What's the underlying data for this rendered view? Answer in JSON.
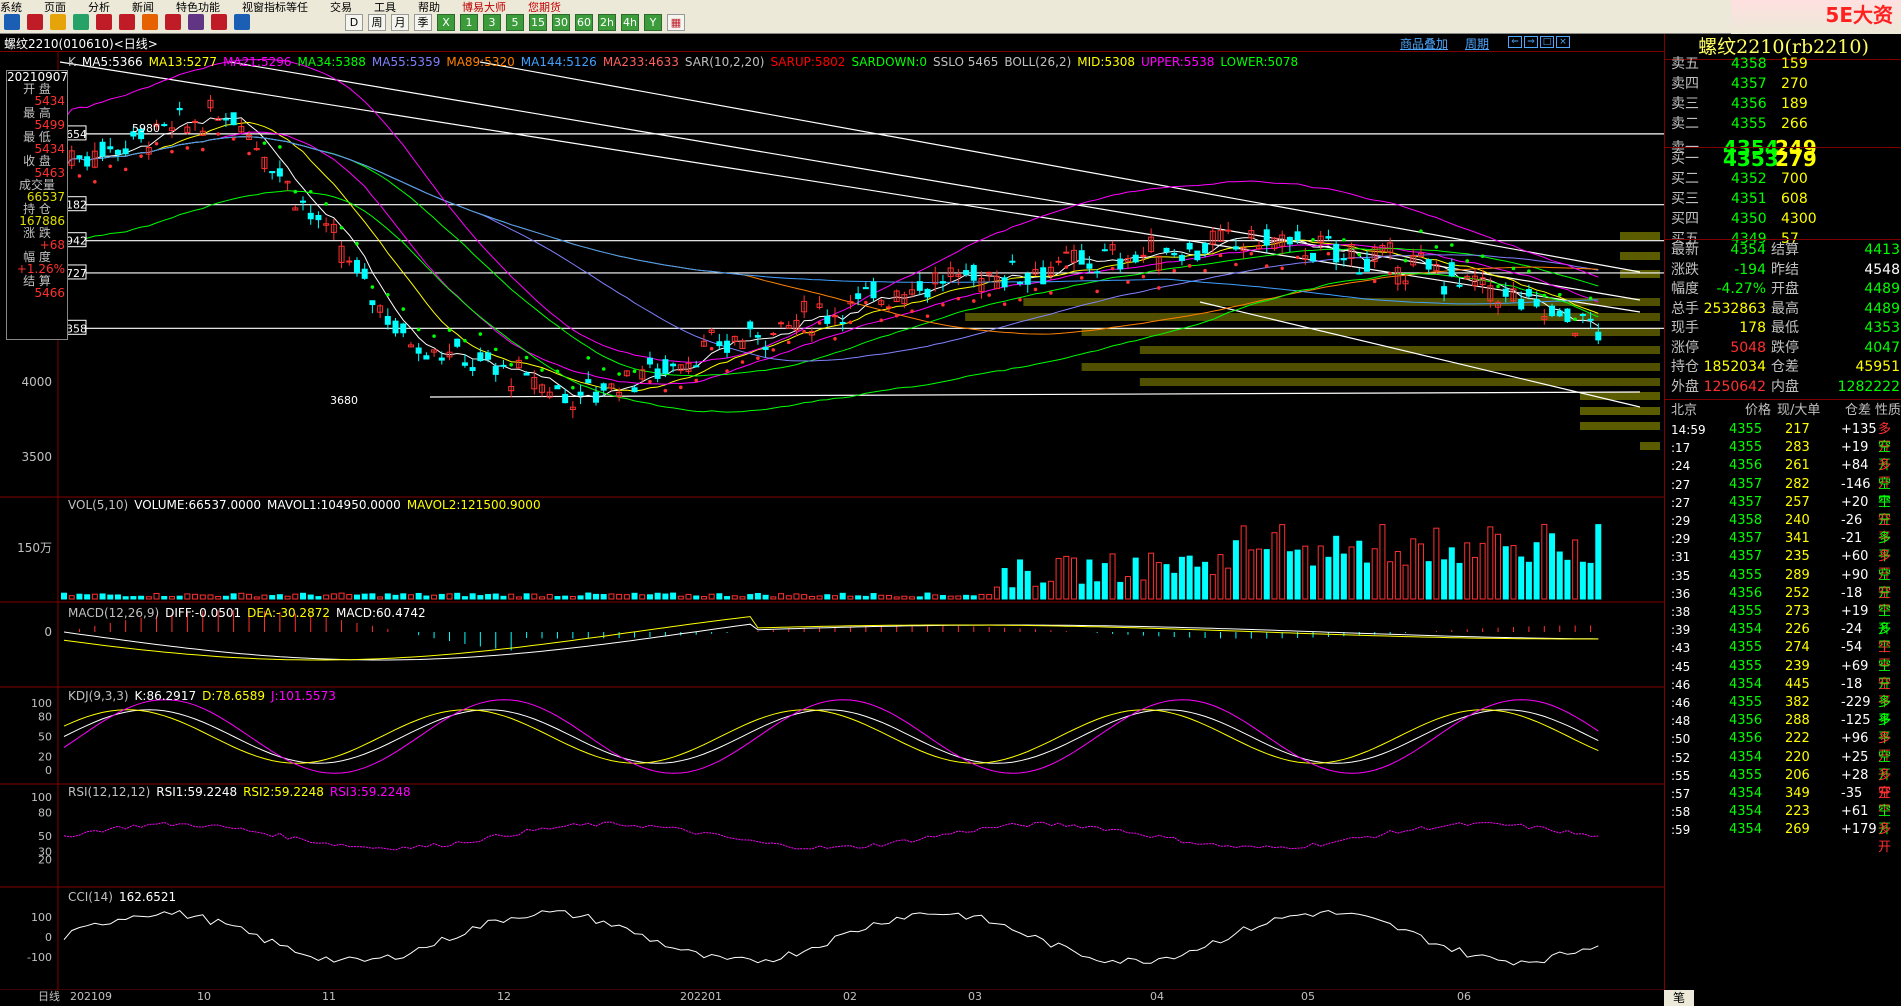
{
  "menu": [
    "系统",
    "页面",
    "分析",
    "新闻",
    "特色功能",
    "视窗指标等任",
    "交易",
    "工具",
    "帮助",
    "博易大师",
    "您期货"
  ],
  "logo_text": "5E大资5etz.com",
  "toolbar_buttons": [
    "D",
    "周",
    "月",
    "季",
    "X",
    "1",
    "3",
    "5",
    "15",
    "30",
    "60",
    "2h",
    "4h",
    "Y",
    "▦"
  ],
  "chart_header": {
    "title": "螺纹2210(010610)<日线>",
    "right_link1": "商品叠加",
    "right_link2": "周期"
  },
  "main_indicators": [
    {
      "text": "K",
      "color": "#c0c0c0"
    },
    {
      "text": "MA5:5366",
      "color": "#ffffff"
    },
    {
      "text": "MA13:5277",
      "color": "#ffff00"
    },
    {
      "text": "MA21:5296",
      "color": "#ff00ff"
    },
    {
      "text": "MA34:5388",
      "color": "#00ff00"
    },
    {
      "text": "MA55:5359",
      "color": "#8080ff"
    },
    {
      "text": "MA89:5320",
      "color": "#ff8000"
    },
    {
      "text": "MA144:5126",
      "color": "#40a0ff"
    },
    {
      "text": "MA233:4633",
      "color": "#ff6060"
    },
    {
      "text": "SAR(10,2,20)",
      "color": "#c0c0c0"
    },
    {
      "text": "SARUP:5802",
      "color": "#ff0000"
    },
    {
      "text": "SARDOWN:0",
      "color": "#00ff00"
    },
    {
      "text": "SSLO 5465",
      "color": "#c0c0c0"
    },
    {
      "text": "BOLL(26,2)",
      "color": "#c0c0c0"
    },
    {
      "text": "MID:5308",
      "color": "#ffff00"
    },
    {
      "text": "UPPER:5538",
      "color": "#ff00ff"
    },
    {
      "text": "LOWER:5078",
      "color": "#00ff00"
    }
  ],
  "ohlc_box": {
    "date": "20210907",
    "items": [
      {
        "label": "开 盘",
        "value": "5434"
      },
      {
        "label": "最 高",
        "value": "5499"
      },
      {
        "label": "最 低",
        "value": "5434"
      },
      {
        "label": "收 盘",
        "value": "5463"
      },
      {
        "label": "成交量",
        "value": "66537"
      },
      {
        "label": "持 仓",
        "value": "167886"
      },
      {
        "label": "涨 跌",
        "value": "+68"
      },
      {
        "label": "幅 度",
        "value": "+1.26%"
      },
      {
        "label": "结 算",
        "value": "5466"
      }
    ]
  },
  "price_labels": {
    "left": [
      "5654",
      "5182",
      "4942",
      "4727",
      "4358"
    ],
    "axis": [
      "4000",
      "3500"
    ],
    "high_mark": "5980",
    "low_mark": "3680"
  },
  "vol_panel": {
    "items": [
      {
        "text": "VOL(5,10)",
        "color": "#c0c0c0"
      },
      {
        "text": "VOLUME:66537.0000",
        "color": "#ffffff"
      },
      {
        "text": "MAVOL1:104950.0000",
        "color": "#ffffff"
      },
      {
        "text": "MAVOL2:121500.9000",
        "color": "#ffff00"
      }
    ],
    "axis": "150万"
  },
  "macd_panel": {
    "items": [
      {
        "text": "MACD(12,26,9)",
        "color": "#c0c0c0"
      },
      {
        "text": "DIFF:-0.0501",
        "color": "#ffffff"
      },
      {
        "text": "DEA:-30.2872",
        "color": "#ffff00"
      },
      {
        "text": "MACD:60.4742",
        "color": "#ffffff"
      }
    ],
    "axis": "0"
  },
  "kdj_panel": {
    "items": [
      {
        "text": "KDJ(9,3,3)",
        "color": "#c0c0c0"
      },
      {
        "text": "K:86.2917",
        "color": "#ffffff"
      },
      {
        "text": "D:78.6589",
        "color": "#ffff00"
      },
      {
        "text": "J:101.5573",
        "color": "#ff00ff"
      }
    ],
    "axis": [
      "100",
      "80",
      "50",
      "20",
      "0"
    ]
  },
  "rsi_panel": {
    "items": [
      {
        "text": "RSI(12,12,12)",
        "color": "#c0c0c0"
      },
      {
        "text": "RSI1:59.2248",
        "color": "#ffffff"
      },
      {
        "text": "RSI2:59.2248",
        "color": "#ffff00"
      },
      {
        "text": "RSI3:59.2248",
        "color": "#ff00ff"
      }
    ],
    "axis": [
      "100",
      "80",
      "50",
      "30",
      "20"
    ]
  },
  "cci_panel": {
    "items": [
      {
        "text": "CCI(14)",
        "color": "#c0c0c0"
      },
      {
        "text": "162.6521",
        "color": "#ffffff"
      }
    ],
    "axis": [
      "100",
      "0",
      "-100"
    ]
  },
  "date_axis": {
    "period": "日线",
    "labels": [
      "202109",
      "10",
      "11",
      "12",
      "202201",
      "02",
      "03",
      "04",
      "05",
      "06"
    ]
  },
  "right_panel": {
    "title": "螺纹2210(rb2210)",
    "asks": [
      {
        "label": "卖五",
        "price": "4358",
        "vol": "159"
      },
      {
        "label": "卖四",
        "price": "4357",
        "vol": "270"
      },
      {
        "label": "卖三",
        "price": "4356",
        "vol": "189"
      },
      {
        "label": "卖二",
        "price": "4355",
        "vol": "266"
      },
      {
        "label": "卖一",
        "price": "4354",
        "vol": "249"
      }
    ],
    "bids": [
      {
        "label": "买一",
        "price": "4353",
        "vol": "279"
      },
      {
        "label": "买二",
        "price": "4352",
        "vol": "700"
      },
      {
        "label": "买三",
        "price": "4351",
        "vol": "608"
      },
      {
        "label": "买四",
        "price": "4350",
        "vol": "4300"
      },
      {
        "label": "买五",
        "price": "4349",
        "vol": "57"
      }
    ],
    "quote": [
      {
        "l1": "最新",
        "v1": "4354",
        "c1": "#00ff00",
        "l2": "结算",
        "v2": "4413",
        "c2": "#00ff00"
      },
      {
        "l1": "涨跌",
        "v1": "-194",
        "c1": "#00ff00",
        "l2": "昨结",
        "v2": "4548",
        "c2": "#ffffff"
      },
      {
        "l1": "幅度",
        "v1": "-4.27%",
        "c1": "#00ff00",
        "l2": "开盘",
        "v2": "4489",
        "c2": "#00ff00"
      },
      {
        "l1": "总手",
        "v1": "2532863",
        "c1": "#ffff00",
        "l2": "最高",
        "v2": "4489",
        "c2": "#00ff00"
      },
      {
        "l1": "现手",
        "v1": "178",
        "c1": "#ffff00",
        "l2": "最低",
        "v2": "4353",
        "c2": "#00ff00"
      },
      {
        "l1": "涨停",
        "v1": "5048",
        "c1": "#ff3030",
        "l2": "跌停",
        "v2": "4047",
        "c2": "#00ff00"
      },
      {
        "l1": "持仓",
        "v1": "1852034",
        "c1": "#ffff00",
        "l2": "仓差",
        "v2": "45951",
        "c2": "#ffff00"
      },
      {
        "l1": "外盘",
        "v1": "1250642",
        "c1": "#ff3030",
        "l2": "内盘",
        "v2": "1282222",
        "c2": "#00ff00"
      }
    ],
    "ticks_header": [
      "北京",
      "价格",
      "现/大单",
      "仓差",
      "性质"
    ],
    "ticks": [
      {
        "t": "14:59",
        "p": "4355",
        "v": "217",
        "d": "+135",
        "n": "多开",
        "nc": "#ff3030"
      },
      {
        "t": ":17",
        "p": "4355",
        "v": "283",
        "d": "+19",
        "n": "空开",
        "nc": "#00ff00"
      },
      {
        "t": ":24",
        "p": "4356",
        "v": "261",
        "d": "+84",
        "n": "多开",
        "nc": "#ff3030"
      },
      {
        "t": ":27",
        "p": "4357",
        "v": "282",
        "d": "-146",
        "n": "空平",
        "nc": "#00ff00"
      },
      {
        "t": ":27",
        "p": "4357",
        "v": "257",
        "d": "+20",
        "n": "空开",
        "nc": "#00ff00"
      },
      {
        "t": ":29",
        "p": "4358",
        "v": "240",
        "d": "-26",
        "n": "空平",
        "nc": "#ff3030"
      },
      {
        "t": ":29",
        "p": "4357",
        "v": "341",
        "d": "-21",
        "n": "多平",
        "nc": "#00ff00"
      },
      {
        "t": ":31",
        "p": "4357",
        "v": "235",
        "d": "+60",
        "n": "多开",
        "nc": "#ff3030"
      },
      {
        "t": ":35",
        "p": "4355",
        "v": "289",
        "d": "+90",
        "n": "空开",
        "nc": "#00ff00"
      },
      {
        "t": ":36",
        "p": "4356",
        "v": "252",
        "d": "-18",
        "n": "空平",
        "nc": "#ff3030"
      },
      {
        "t": ":38",
        "p": "4355",
        "v": "273",
        "d": "+19",
        "n": "空开",
        "nc": "#00ff00"
      },
      {
        "t": ":39",
        "p": "4354",
        "v": "226",
        "d": "-24",
        "n": "多平",
        "nc": "#00ff00"
      },
      {
        "t": ":43",
        "p": "4355",
        "v": "274",
        "d": "-54",
        "n": "空平",
        "nc": "#ff3030"
      },
      {
        "t": ":45",
        "p": "4355",
        "v": "239",
        "d": "+69",
        "n": "空开",
        "nc": "#00ff00"
      },
      {
        "t": ":46",
        "p": "4354",
        "v": "445",
        "d": "-18",
        "n": "空平",
        "nc": "#ff3030"
      },
      {
        "t": ":46",
        "p": "4355",
        "v": "382",
        "d": "-229",
        "n": "多平",
        "nc": "#00ff00"
      },
      {
        "t": ":48",
        "p": "4356",
        "v": "288",
        "d": "-125",
        "n": "多平",
        "nc": "#00ff00"
      },
      {
        "t": ":50",
        "p": "4356",
        "v": "222",
        "d": "+96",
        "n": "多开",
        "nc": "#ff3030"
      },
      {
        "t": ":52",
        "p": "4354",
        "v": "220",
        "d": "+25",
        "n": "空开",
        "nc": "#00ff00"
      },
      {
        "t": ":55",
        "p": "4355",
        "v": "206",
        "d": "+28",
        "n": "多开",
        "nc": "#ff3030"
      },
      {
        "t": ":57",
        "p": "4354",
        "v": "349",
        "d": "-35",
        "n": "空平",
        "nc": "#ff3030"
      },
      {
        "t": ":58",
        "p": "4354",
        "v": "223",
        "d": "+61",
        "n": "空开",
        "nc": "#00ff00"
      },
      {
        "t": ":59",
        "p": "4354",
        "v": "269",
        "d": "+179",
        "n": "多开",
        "nc": "#ff3030"
      }
    ],
    "footer_tab": "笔"
  },
  "chart_data": {
    "type": "line",
    "x": [
      "2021-09",
      "2021-10",
      "2021-11",
      "2021-12",
      "2022-01",
      "2022-02",
      "2022-03",
      "2022-04",
      "2022-05",
      "2022-06"
    ],
    "series": [
      {
        "values": [
          5480,
          5800,
          4300,
          3900,
          4300,
          4650,
          4800,
          4950,
          4750,
          4354
        ]
      }
    ],
    "ylim": [
      3300,
      6100
    ],
    "grid": false
  },
  "colors": {
    "up": "#ff3030",
    "down": "#00ffff",
    "divider": "#800000",
    "sr_band": "#6b6b00"
  }
}
